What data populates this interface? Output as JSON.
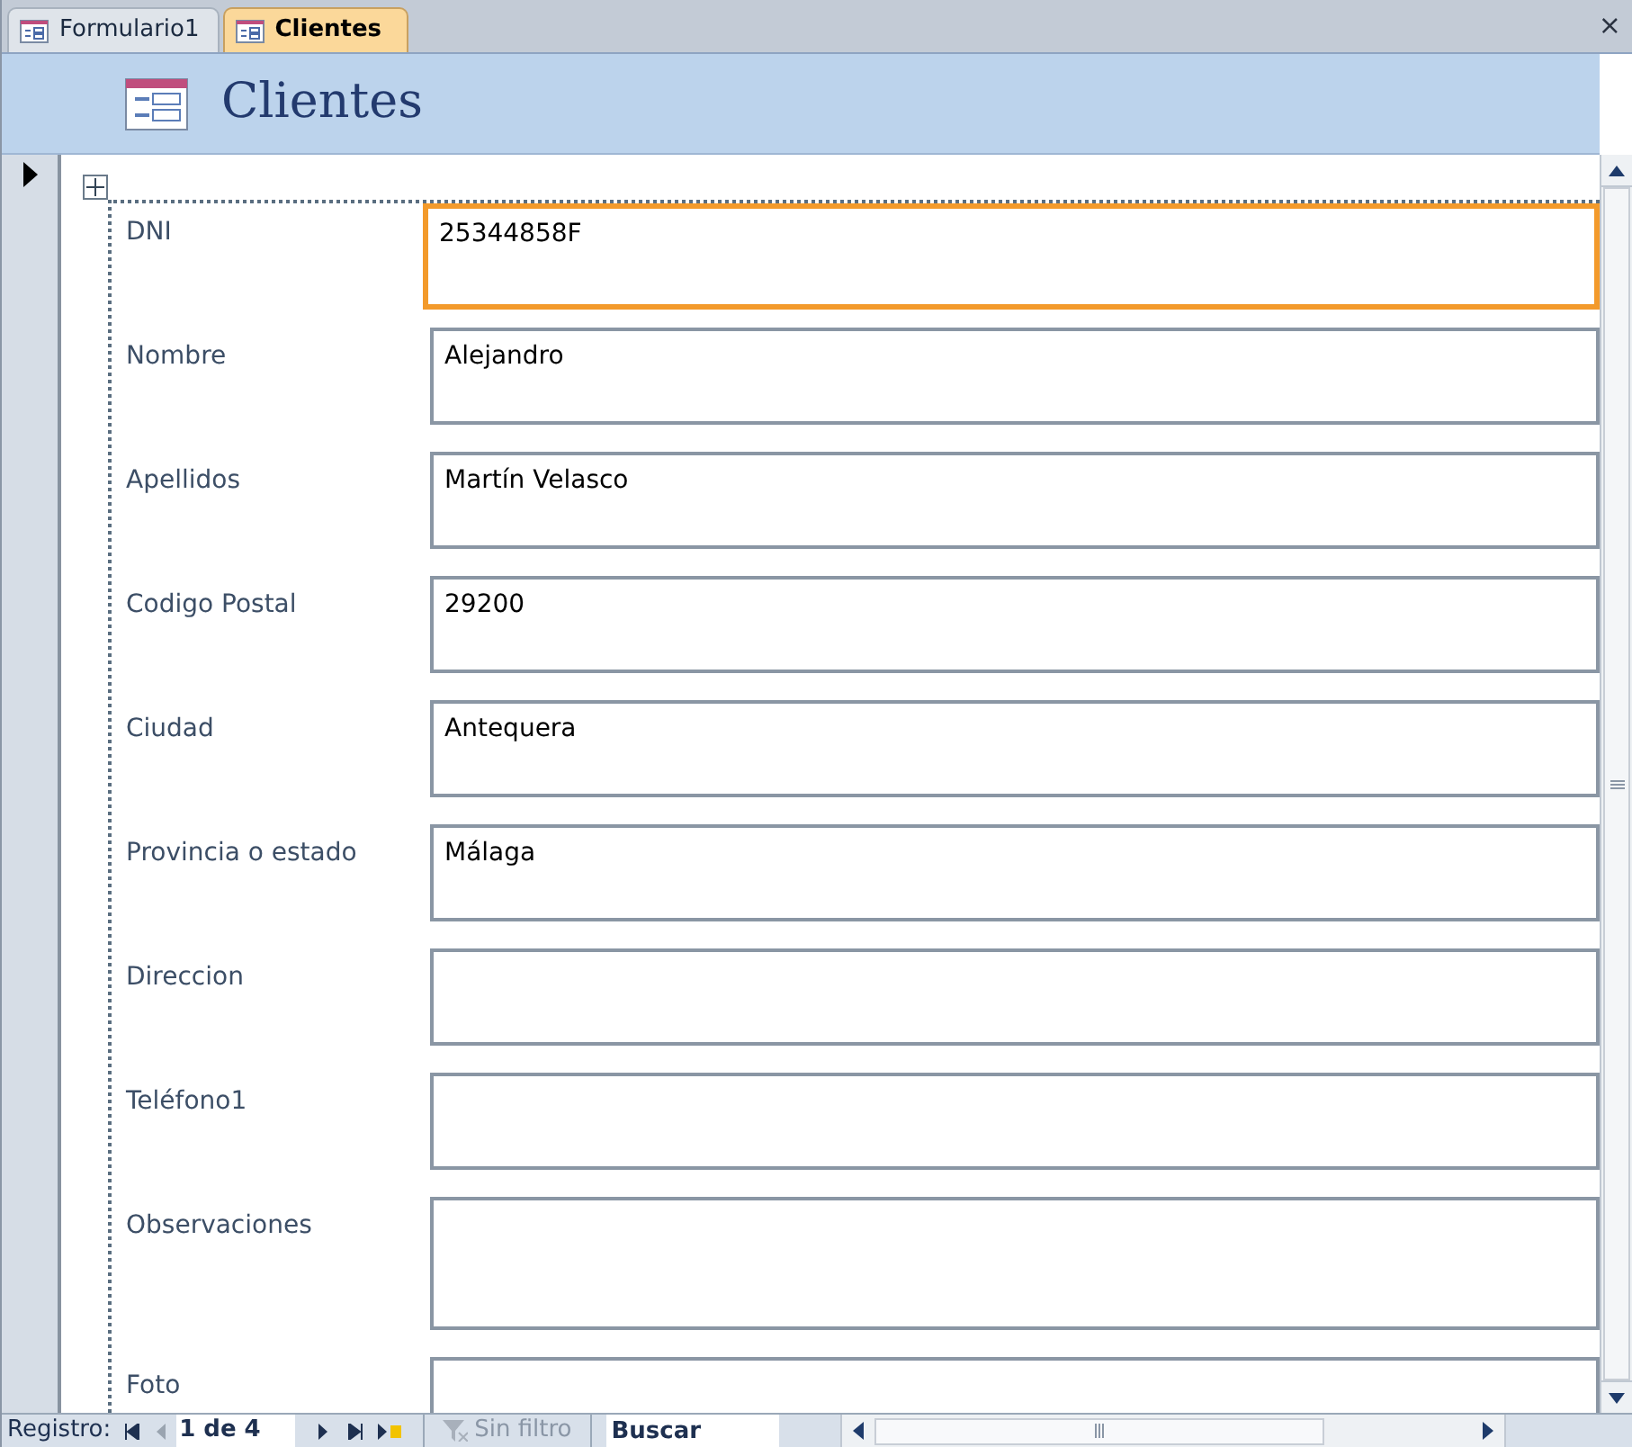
{
  "tabs": [
    {
      "label": "Formulario1",
      "selected": false
    },
    {
      "label": "Clientes",
      "selected": true
    }
  ],
  "close": "×",
  "form_title": "Clientes",
  "fields": [
    {
      "label": "DNI",
      "value": "25344858F",
      "focused": true,
      "multiline": false
    },
    {
      "label": "Nombre",
      "value": "Alejandro",
      "focused": false,
      "multiline": false
    },
    {
      "label": "Apellidos",
      "value": "Martín Velasco",
      "focused": false,
      "multiline": false
    },
    {
      "label": "Codigo Postal",
      "value": "29200",
      "focused": false,
      "multiline": false
    },
    {
      "label": "Ciudad",
      "value": "Antequera",
      "focused": false,
      "multiline": false
    },
    {
      "label": "Provincia o estado",
      "value": "Málaga",
      "focused": false,
      "multiline": false
    },
    {
      "label": "Direccion",
      "focused": false,
      "multiline": false
    },
    {
      "label": "Teléfono1",
      "focused": false,
      "multiline": false
    },
    {
      "label": "Observaciones",
      "focused": false,
      "multiline": true
    },
    {
      "label": "Foto",
      "focused": false,
      "multiline": false
    }
  ],
  "navigation": {
    "label": "Registro:",
    "record": "1 de 4",
    "filter": "Sin filtro",
    "search": "Buscar"
  }
}
